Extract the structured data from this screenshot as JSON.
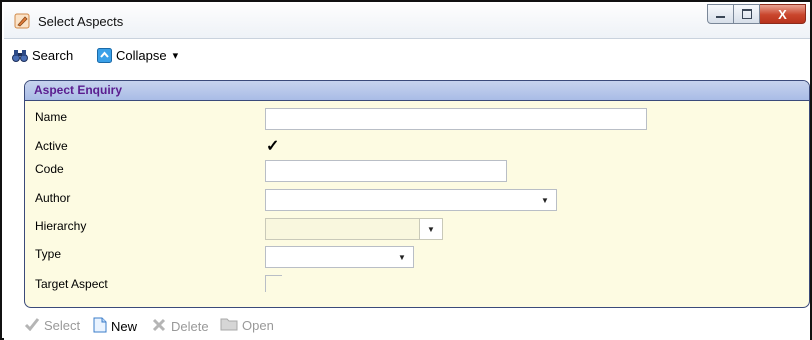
{
  "window": {
    "title": "Select Aspects",
    "controls": {
      "minimize_icon": "minimize-icon",
      "maximize_icon": "maximize-icon",
      "close_label": "X"
    }
  },
  "toolbar": {
    "search_label": "Search",
    "collapse_label": "Collapse",
    "collapse_caret": "▾"
  },
  "panel": {
    "title": "Aspect Enquiry",
    "fields": {
      "name_label": "Name",
      "name_value": "",
      "active_label": "Active",
      "active_checked": "✓",
      "code_label": "Code",
      "code_value": "",
      "author_label": "Author",
      "author_value": "",
      "hierarchy_label": "Hierarchy",
      "hierarchy_value": "",
      "type_label": "Type",
      "type_value": "",
      "target_aspect_label": "Target Aspect"
    },
    "dropdown_glyph": "▼"
  },
  "bottom_toolbar": {
    "select_label": "Select",
    "new_label": "New",
    "delete_label": "Delete",
    "open_label": "Open"
  },
  "colors": {
    "panel_header_text": "#5a1d8f",
    "panel_background": "#fdfbe2",
    "close_button": "#c9452c"
  }
}
